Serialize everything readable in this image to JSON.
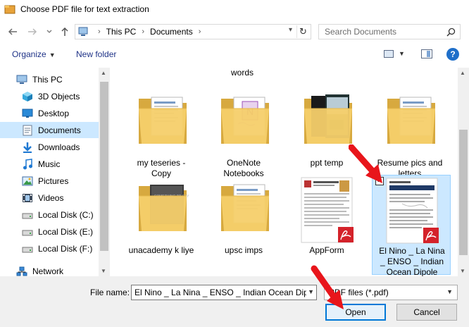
{
  "window": {
    "title": "Choose PDF file for text extraction",
    "app_icon": "folder-icon"
  },
  "address_bar": {
    "crumbs": [
      "This PC",
      "Documents"
    ],
    "icon": "pc-icon"
  },
  "search": {
    "placeholder": "Search Documents",
    "value": ""
  },
  "toolbar": {
    "organize_label": "Organize",
    "new_folder_label": "New folder",
    "help_label": "?"
  },
  "sidebar": {
    "items": [
      {
        "label": "This PC",
        "icon": "pc-icon"
      },
      {
        "label": "3D Objects",
        "icon": "cube-icon"
      },
      {
        "label": "Desktop",
        "icon": "desktop-icon"
      },
      {
        "label": "Documents",
        "icon": "documents-icon",
        "selected": true
      },
      {
        "label": "Downloads",
        "icon": "download-icon"
      },
      {
        "label": "Music",
        "icon": "music-icon"
      },
      {
        "label": "Pictures",
        "icon": "pictures-icon"
      },
      {
        "label": "Videos",
        "icon": "videos-icon"
      },
      {
        "label": "Local Disk (C:)",
        "icon": "drive-icon"
      },
      {
        "label": "Local Disk (E:)",
        "icon": "drive-icon"
      },
      {
        "label": "Local Disk (F:)",
        "icon": "drive-icon"
      },
      {
        "label": "Network",
        "icon": "network-icon"
      }
    ]
  },
  "files": {
    "partial_top_label": "words",
    "items": [
      {
        "label": "my teseries -\nCopy",
        "type": "folder",
        "preview": "documents"
      },
      {
        "label": "OneNote\nNotebooks",
        "type": "folder",
        "preview": "onenote"
      },
      {
        "label": "ppt temp",
        "type": "folder",
        "preview": "slides"
      },
      {
        "label": "Resume pics and\nletters",
        "type": "folder",
        "preview": "documents"
      },
      {
        "label": "unacademy k liye",
        "type": "folder",
        "preview": "dark"
      },
      {
        "label": "upsc imps",
        "type": "folder",
        "preview": "documents"
      },
      {
        "label": "AppForm",
        "type": "pdf"
      },
      {
        "label": "El Nino _ La Nina\n_ ENSO _ Indian\nOcean Dipole",
        "type": "pdf",
        "selected": true
      }
    ]
  },
  "footer": {
    "file_name_label": "File name:",
    "file_name_value": "El Nino _ La Nina _ ENSO _ Indian Ocean Dipole.pdf",
    "file_type": "PDF files (*.pdf)",
    "open_label": "Open",
    "cancel_label": "Cancel"
  },
  "colors": {
    "accent": "#0078d7",
    "selection": "#cce8ff",
    "annotation_arrow": "#e8151b"
  }
}
